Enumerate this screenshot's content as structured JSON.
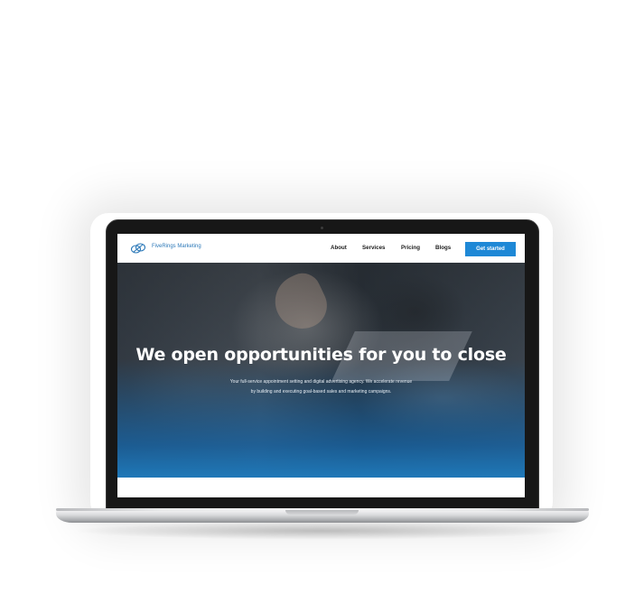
{
  "brand": {
    "name": "FiveRings Marketing",
    "accent_color": "#1e88d6",
    "logo_icon": "linked-rings-icon"
  },
  "nav": {
    "links": [
      {
        "label": "About"
      },
      {
        "label": "Services"
      },
      {
        "label": "Pricing"
      },
      {
        "label": "Blogs"
      }
    ],
    "cta_label": "Get started"
  },
  "hero": {
    "title": "We open opportunities for you to close",
    "subtitle_line1": "Your full-service appointment setting and digital advertising agency. We accelerate revenue",
    "subtitle_line2": "by building and executing goal-based sales and marketing campaigns."
  },
  "device": {
    "type": "laptop-mockup"
  }
}
